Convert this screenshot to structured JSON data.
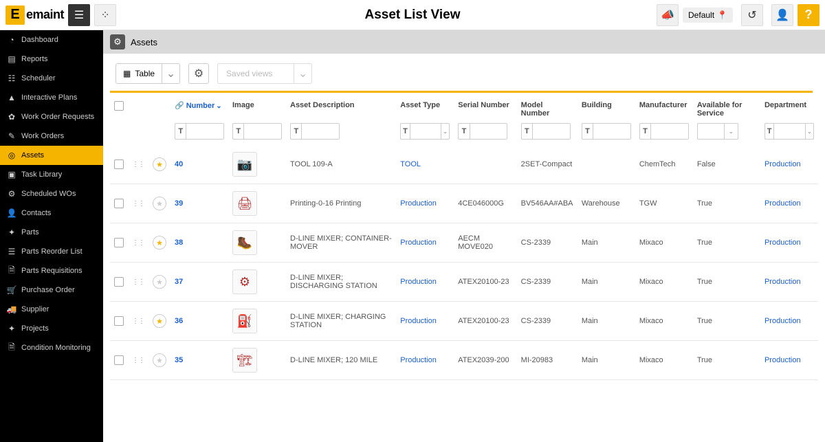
{
  "header": {
    "brand": "emaint",
    "title": "Asset List View",
    "default_label": "Default"
  },
  "sidebar": {
    "items": [
      {
        "label": "Dashboard",
        "icon": "◔"
      },
      {
        "label": "Reports",
        "icon": "▤"
      },
      {
        "label": "Scheduler",
        "icon": "☷"
      },
      {
        "label": "Interactive Plans",
        "icon": "▲"
      },
      {
        "label": "Work Order Requests",
        "icon": "✿"
      },
      {
        "label": "Work Orders",
        "icon": "✎"
      },
      {
        "label": "Assets",
        "icon": "◎",
        "active": true
      },
      {
        "label": "Task Library",
        "icon": "▣"
      },
      {
        "label": "Scheduled WOs",
        "icon": "⚙"
      },
      {
        "label": "Contacts",
        "icon": "👤"
      },
      {
        "label": "Parts",
        "icon": "✦"
      },
      {
        "label": "Parts Reorder List",
        "icon": "☰"
      },
      {
        "label": "Parts Requisitions",
        "icon": "🗎"
      },
      {
        "label": "Purchase Order",
        "icon": "🛒"
      },
      {
        "label": "Supplier",
        "icon": "🚚"
      },
      {
        "label": "Projects",
        "icon": "✦"
      },
      {
        "label": "Condition Monitoring",
        "icon": "🗎"
      }
    ]
  },
  "panel": {
    "title": "Assets"
  },
  "toolbar": {
    "view_mode": "Table",
    "saved_views_placeholder": "Saved views"
  },
  "columns": {
    "number": "Number",
    "image": "Image",
    "asset_description": "Asset Description",
    "asset_type": "Asset Type",
    "serial_number": "Serial Number",
    "model_number": "Model Number",
    "building": "Building",
    "manufacturer": "Manufacturer",
    "available_for_service": "Available for Service",
    "department": "Department"
  },
  "rows": [
    {
      "starred": true,
      "number": "40",
      "desc": "TOOL 109-A",
      "type": "TOOL",
      "type_link": true,
      "serial": "",
      "model": "2SET-Compact",
      "building": "",
      "manufacturer": "ChemTech",
      "available": "False",
      "department": "Production"
    },
    {
      "starred": false,
      "number": "39",
      "desc": "Printing-0-16 Printing",
      "type": "Production",
      "type_link": true,
      "serial": "4CE046000G",
      "model": "BV546AA#ABA",
      "building": "Warehouse",
      "manufacturer": "TGW",
      "available": "True",
      "department": "Production"
    },
    {
      "starred": true,
      "number": "38",
      "desc": "D-LINE MIXER; CONTAINER-MOVER",
      "type": "Production",
      "type_link": true,
      "serial": "AECM MOVE020",
      "model": "CS-2339",
      "building": "Main",
      "manufacturer": "Mixaco",
      "available": "True",
      "department": "Production"
    },
    {
      "starred": false,
      "number": "37",
      "desc": "D-LINE MIXER; DISCHARGING STATION",
      "type": "Production",
      "type_link": true,
      "serial": "ATEX20100-23",
      "model": "CS-2339",
      "building": "Main",
      "manufacturer": "Mixaco",
      "available": "True",
      "department": "Production"
    },
    {
      "starred": true,
      "number": "36",
      "desc": "D-LINE MIXER; CHARGING STATION",
      "type": "Production",
      "type_link": true,
      "serial": "ATEX20100-23",
      "model": "CS-2339",
      "building": "Main",
      "manufacturer": "Mixaco",
      "available": "True",
      "department": "Production"
    },
    {
      "starred": false,
      "number": "35",
      "desc": "D-LINE MIXER; 120 MILE",
      "type": "Production",
      "type_link": true,
      "serial": "ATEX2039-200",
      "model": "MI-20983",
      "building": "Main",
      "manufacturer": "Mixaco",
      "available": "True",
      "department": "Production"
    }
  ]
}
